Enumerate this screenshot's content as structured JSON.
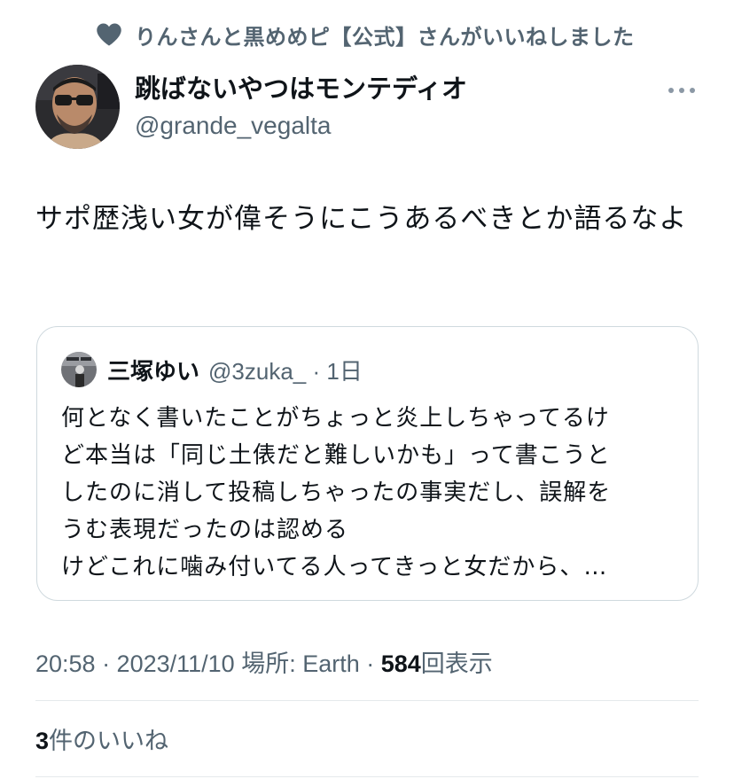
{
  "social_context": {
    "icon": "heart-icon",
    "text": "りんさんと黒めめピ【公式】さんがいいねしました"
  },
  "author": {
    "display_name": "跳ばないやつはモンテディオ",
    "handle": "@grande_vegalta"
  },
  "tweet": {
    "text": "サポ歴浅い女が偉そうにこうあるべきとか語るなよ"
  },
  "quoted_tweet": {
    "display_name": "三塚ゆい",
    "handle_and_time": "@3zuka_ · 1日",
    "body_lines": [
      "何となく書いたことがちょっと炎上しちゃってるけ",
      "ど本当は「同じ土俵だと難しいかも」って書こうと",
      "したのに消して投稿しちゃったの事実だし、誤解を",
      "うむ表現だったのは認める",
      "けどこれに噛み付いてる人ってきっと女だから、…"
    ]
  },
  "meta": {
    "time_date_location": "20:58 · 2023/11/10 場所: Earth · ",
    "views_count": "584",
    "views_label": "回表示"
  },
  "likes": {
    "count": "3",
    "label": "件のいいね"
  },
  "colors": {
    "secondary_text": "#536471",
    "primary_text": "#0f1419",
    "border": "#cfd9de"
  }
}
